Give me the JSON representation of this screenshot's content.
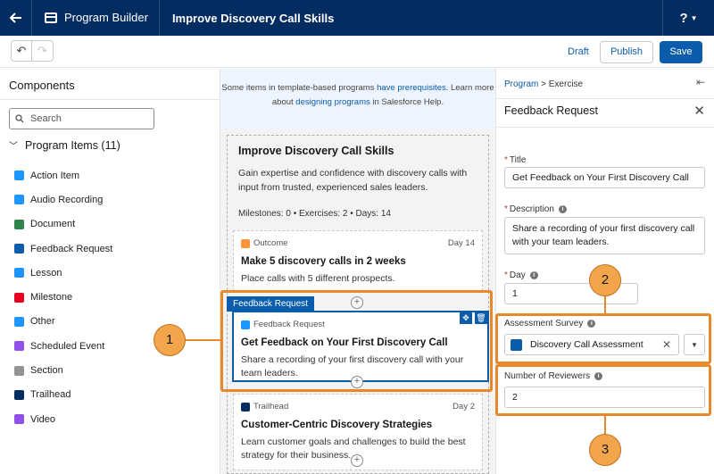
{
  "header": {
    "back_icon": "arrow-left-icon",
    "app_name": "Program Builder",
    "program_title": "Improve Discovery Call Skills",
    "help_label": "?"
  },
  "toolbar": {
    "status": "Draft",
    "publish_label": "Publish",
    "save_label": "Save"
  },
  "components": {
    "title": "Components",
    "search_placeholder": "Search",
    "group_label": "Program Items (11)",
    "items": [
      {
        "label": "Action Item",
        "color": "#1b96ff"
      },
      {
        "label": "Audio Recording",
        "color": "#1b96ff"
      },
      {
        "label": "Document",
        "color": "#2e844a"
      },
      {
        "label": "Feedback Request",
        "color": "#0b5cab"
      },
      {
        "label": "Lesson",
        "color": "#1b96ff"
      },
      {
        "label": "Milestone",
        "color": "#ea001e"
      },
      {
        "label": "Other",
        "color": "#1b96ff"
      },
      {
        "label": "Scheduled Event",
        "color": "#9050e9"
      },
      {
        "label": "Section",
        "color": "#939393"
      },
      {
        "label": "Trailhead",
        "color": "#032d60"
      },
      {
        "label": "Video",
        "color": "#9050e9"
      }
    ]
  },
  "canvas": {
    "notice_pre": "Some items in template-based programs ",
    "notice_link1": "have prerequisites",
    "notice_mid": ". Learn more about ",
    "notice_link2": "designing programs",
    "notice_post": " in Salesforce Help.",
    "program_title": "Improve Discovery Call Skills",
    "program_desc": "Gain expertise and confidence with discovery calls with input from trusted, experienced sales leaders.",
    "program_stats": "Milestones: 0 • Exercises: 2 • Days: 14",
    "outcome": {
      "type": "Outcome",
      "day": "Day 14",
      "title": "Make 5 discovery calls in 2 weeks",
      "desc": "Place calls with 5 different prospects."
    },
    "selected_tab": "Feedback Request",
    "feedback": {
      "type": "Feedback Request",
      "title": "Get Feedback on Your First Discovery Call",
      "desc": "Share a recording of your first discovery call with your team leaders."
    },
    "trailhead": {
      "type": "Trailhead",
      "day": "Day 2",
      "title": "Customer-Centric Discovery Strategies",
      "desc": "Learn customer goals and challenges to build the best strategy for their business."
    }
  },
  "properties": {
    "crumb_link": "Program",
    "crumb_rest": " > Exercise",
    "panel_title": "Feedback Request",
    "title_label": "Title",
    "title_value": "Get Feedback on Your First Discovery Call",
    "desc_label": "Description",
    "desc_value": "Share a recording of your first discovery call with your team leaders.",
    "day_label": "Day",
    "day_value": "1",
    "survey_label": "Assessment Survey",
    "survey_value": "Discovery Call Assessment",
    "reviewers_label": "Number of Reviewers",
    "reviewers_value": "2"
  },
  "callouts": [
    "1",
    "2",
    "3"
  ]
}
